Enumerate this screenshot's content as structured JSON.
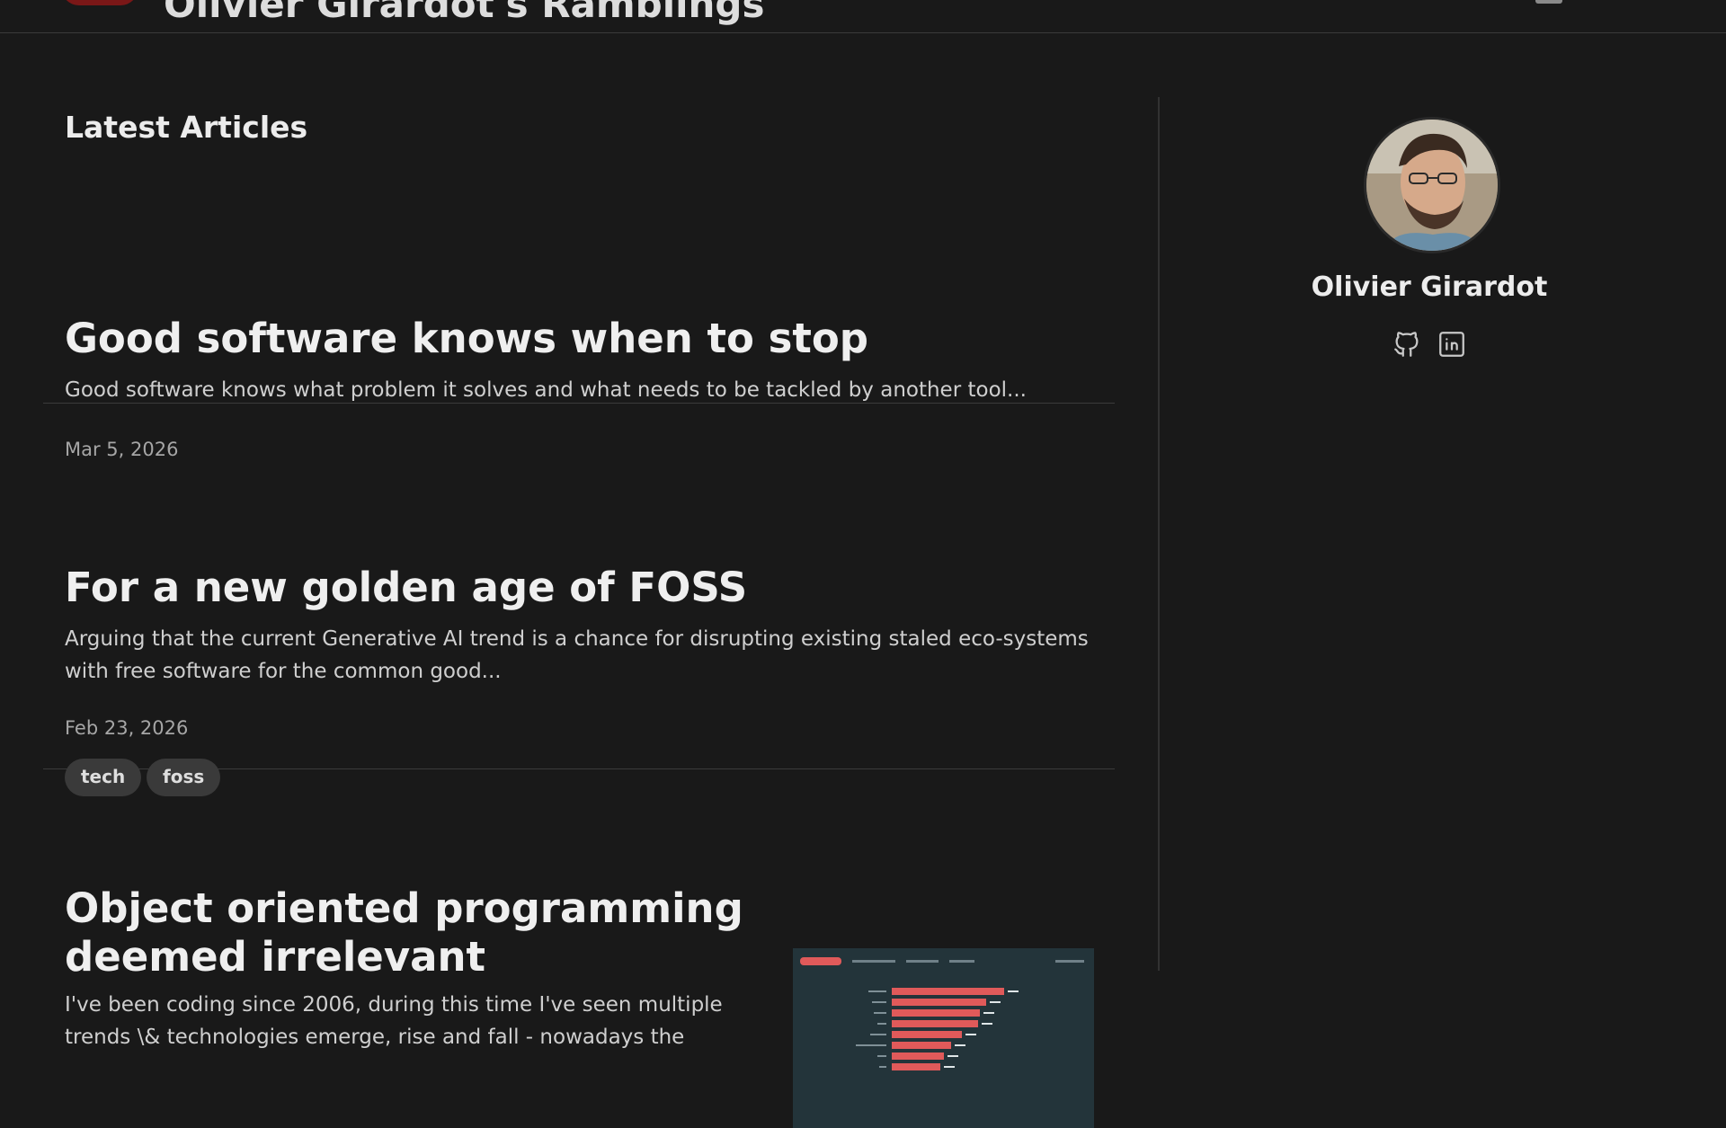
{
  "header": {
    "site_title": "Olivier Girardot's Ramblings"
  },
  "main": {
    "section_title": "Latest Articles",
    "articles": [
      {
        "title": "Good software knows when to stop",
        "summary": "Good software knows what problem it solves and what needs to be tackled by another tool...",
        "date": "Mar 5, 2026",
        "tags": []
      },
      {
        "title": "For a new golden age of FOSS",
        "summary_line1": "Arguing that the current Generative AI trend is a chance for disrupting existing staled eco-systems",
        "summary_line2": "with free software for the common good...",
        "date": "Feb 23, 2026",
        "tags": [
          "tech",
          "foss"
        ]
      },
      {
        "title_line1": "Object oriented programming",
        "title_line2": "deemed irrelevant",
        "summary_line1": "I've been coding since 2006, during this time I've seen multiple",
        "summary_line2": "trends \\& technologies emerge, rise and fall - nowadays the",
        "has_thumbnail": true
      }
    ]
  },
  "sidebar": {
    "author_name": "Olivier Girardot",
    "social": [
      "github-icon",
      "linkedin-icon"
    ]
  },
  "colors": {
    "background": "#191919",
    "text": "#e9e9e9",
    "muted": "#a6a6a6",
    "tag_bg": "#3a3a3a",
    "chart_bar": "#e05a5a"
  }
}
